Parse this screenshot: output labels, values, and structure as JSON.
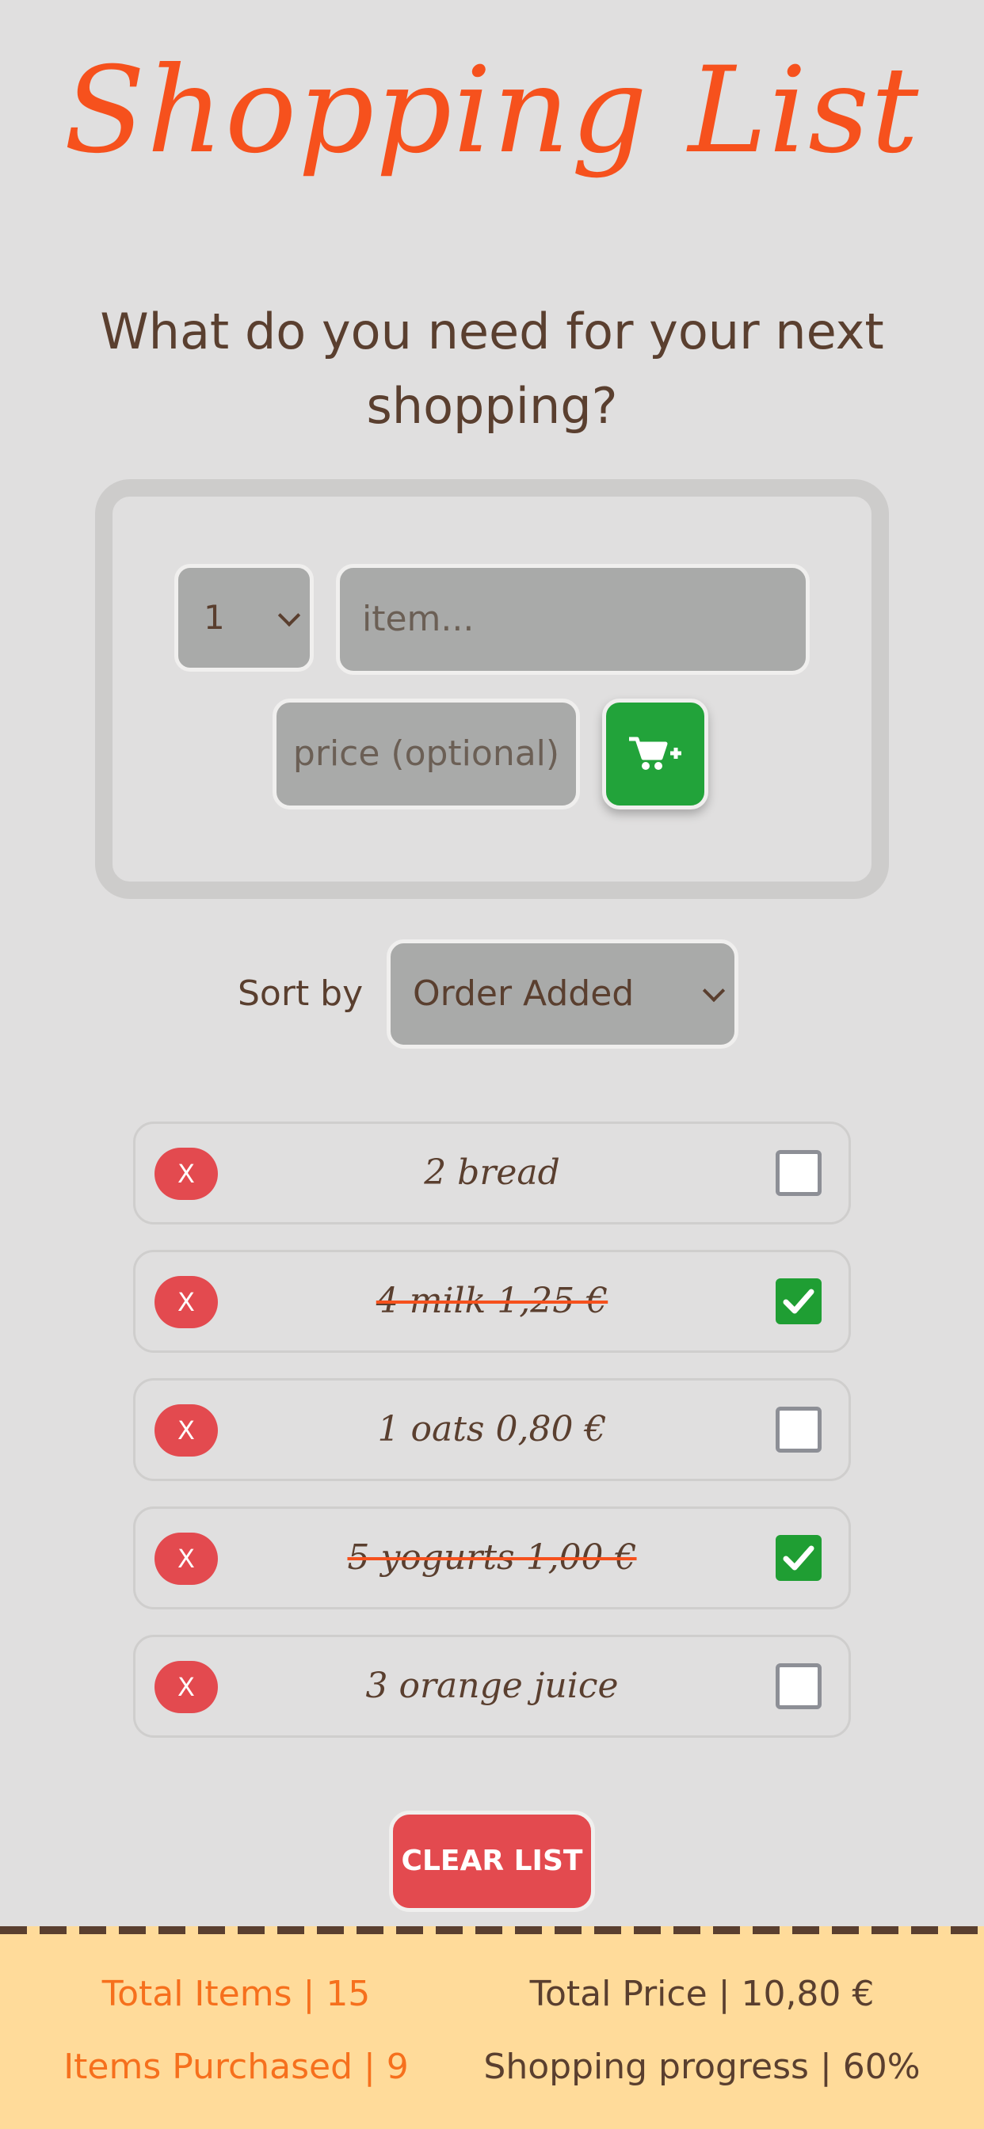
{
  "header": {
    "title": "Shopping List",
    "subtitle": "What do you need for your next shopping?"
  },
  "form": {
    "quantity_value": "1",
    "item_placeholder": "item...",
    "price_placeholder": "price (optional)",
    "add_icon": "cart-plus-icon"
  },
  "sort": {
    "label": "Sort by",
    "selected": "Order Added"
  },
  "items": [
    {
      "delete_label": "X",
      "text": "2 bread",
      "checked": false
    },
    {
      "delete_label": "X",
      "text": "4 milk 1,25 €",
      "checked": true
    },
    {
      "delete_label": "X",
      "text": "1 oats 0,80 €",
      "checked": false
    },
    {
      "delete_label": "X",
      "text": "5 yogurts 1,00 €",
      "checked": true
    },
    {
      "delete_label": "X",
      "text": "3 orange juice",
      "checked": false
    }
  ],
  "clear_button": "CLEAR LIST",
  "stats": {
    "total_items": "Total Items | 15",
    "total_price": "Total Price | 10,80 €",
    "items_purchased": "Items Purchased | 9",
    "progress": "Shopping progress | 60%"
  },
  "colors": {
    "accent": "#f6511d",
    "background": "#e0dfdf",
    "text": "#5a3f2f",
    "add_green": "#22a33a",
    "delete_red": "#e34a4f",
    "footer": "#ffdb9a"
  }
}
